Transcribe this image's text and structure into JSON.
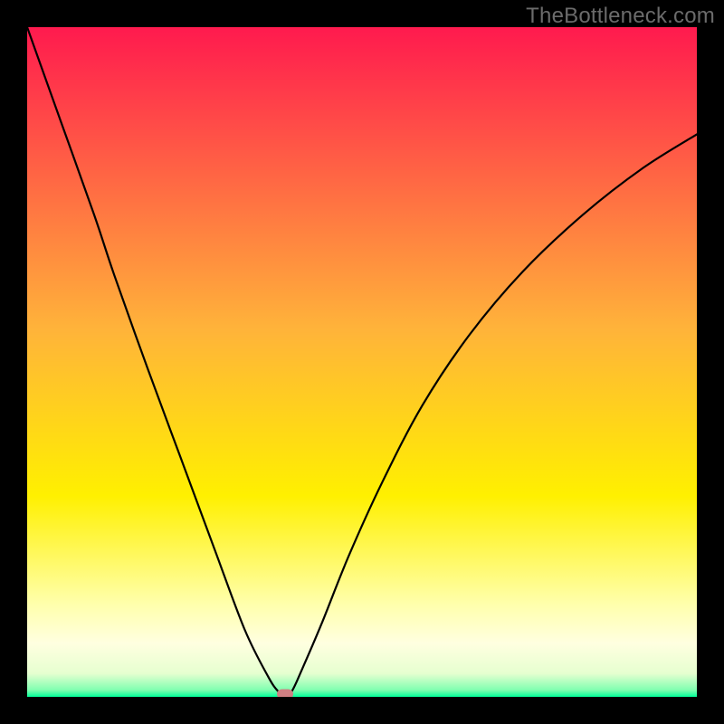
{
  "watermark": "TheBottleneck.com",
  "chart_data": {
    "type": "line",
    "title": "",
    "xlabel": "",
    "ylabel": "",
    "xlim": [
      0,
      100
    ],
    "ylim": [
      0,
      100
    ],
    "background_gradient": {
      "stops": [
        {
          "pos": 0.0,
          "color": "#ff1a4e"
        },
        {
          "pos": 0.45,
          "color": "#ffb33a"
        },
        {
          "pos": 0.7,
          "color": "#fff000"
        },
        {
          "pos": 0.86,
          "color": "#ffffaa"
        },
        {
          "pos": 0.92,
          "color": "#ffffe0"
        },
        {
          "pos": 0.965,
          "color": "#e6ffd0"
        },
        {
          "pos": 0.99,
          "color": "#7fffb0"
        },
        {
          "pos": 1.0,
          "color": "#00ff99"
        }
      ]
    },
    "series": [
      {
        "name": "bottleneck-curve",
        "x": [
          0,
          5,
          10,
          13,
          18,
          23,
          28,
          32.5,
          36,
          37.5,
          38.5,
          39.5,
          41,
          44,
          48,
          53,
          59,
          66,
          74,
          83,
          92,
          100
        ],
        "y": [
          100,
          86,
          72,
          63,
          49,
          35.5,
          22,
          10,
          3,
          0.8,
          0.2,
          0.8,
          4,
          11,
          21,
          32,
          43.5,
          54,
          63.5,
          72,
          79,
          84
        ]
      }
    ],
    "marker": {
      "x": 38.5,
      "y": 0.4,
      "color": "#cf7f82"
    },
    "frame_color": "#000000"
  }
}
